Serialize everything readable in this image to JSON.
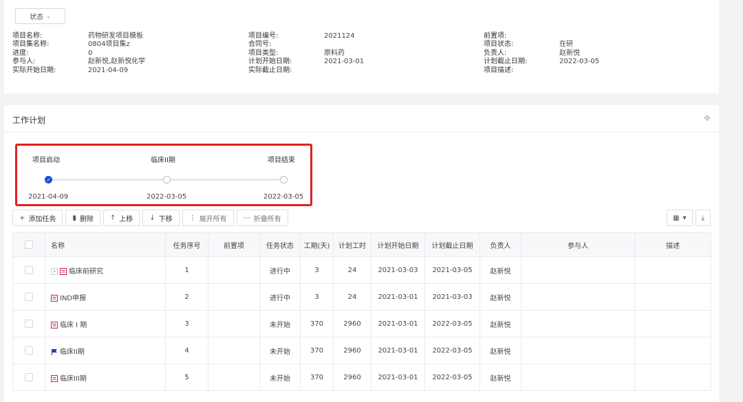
{
  "status_button": {
    "label": "状态",
    "icon": "chevron-down-icon"
  },
  "project_info": {
    "col1": [
      {
        "label": "项目名称:",
        "value": "药物研发项目模板"
      },
      {
        "label": "项目集名称:",
        "value": "0804项目集z"
      },
      {
        "label": "进度:",
        "value": "0"
      },
      {
        "label": "参与人:",
        "value": "赵新悦,赵新悦化学"
      },
      {
        "label": "实际开始日期:",
        "value": "2021-04-09"
      }
    ],
    "col2": [
      {
        "label": "项目编号:",
        "value": "2021124"
      },
      {
        "label": "合同号:",
        "value": ""
      },
      {
        "label": "项目类型:",
        "value": "原料药"
      },
      {
        "label": "计划开始日期:",
        "value": "2021-03-01"
      },
      {
        "label": "实际截止日期:",
        "value": ""
      }
    ],
    "col3": [
      {
        "label": "前置项:",
        "value": ""
      },
      {
        "label": "项目状态:",
        "value": "在研"
      },
      {
        "label": "负责人:",
        "value": "赵新悦"
      },
      {
        "label": "计划截止日期:",
        "value": "2022-03-05"
      },
      {
        "label": "项目描述:",
        "value": ""
      }
    ]
  },
  "plan": {
    "title": "工作计划",
    "milestones": [
      {
        "label": "项目启动",
        "date": "2021-04-09",
        "done": true
      },
      {
        "label": "临床II期",
        "date": "2022-03-05",
        "done": false
      },
      {
        "label": "项目结束",
        "date": "2022-03-05",
        "done": false
      }
    ],
    "highlight_color": "#e02020"
  },
  "toolbar": {
    "add_task": "添加任务",
    "delete": "删除",
    "move_up": "上移",
    "move_down": "下移",
    "expand_all": "展开所有",
    "collapse_all": "折叠所有"
  },
  "table": {
    "headers": [
      "名称",
      "任务序号",
      "前置项",
      "任务状态",
      "工期(天)",
      "计划工时",
      "计划开始日期",
      "计划截止日期",
      "负责人",
      "参与人",
      "描述"
    ],
    "rows": [
      {
        "name": "临床前研究",
        "seq": "1",
        "pre": "",
        "status": "进行中",
        "days": "3",
        "hours": "24",
        "start": "2021-03-03",
        "end": "2021-03-05",
        "owner": "赵新悦",
        "participants": "",
        "desc": "",
        "icon": "red-doc-icon",
        "expandable": true
      },
      {
        "name": "IND申报",
        "seq": "2",
        "pre": "",
        "status": "进行中",
        "days": "3",
        "hours": "24",
        "start": "2021-03-01",
        "end": "2021-03-03",
        "owner": "赵新悦",
        "participants": "",
        "desc": "",
        "icon": "red-doc-icon",
        "expandable": false
      },
      {
        "name": "临床 I 期",
        "seq": "3",
        "pre": "",
        "status": "未开始",
        "days": "370",
        "hours": "2960",
        "start": "2021-03-01",
        "end": "2022-03-05",
        "owner": "赵新悦",
        "participants": "",
        "desc": "",
        "icon": "red-doc-icon",
        "expandable": false
      },
      {
        "name": "临床II期",
        "seq": "4",
        "pre": "",
        "status": "未开始",
        "days": "370",
        "hours": "2960",
        "start": "2021-03-01",
        "end": "2022-03-05",
        "owner": "赵新悦",
        "participants": "",
        "desc": "",
        "icon": "blue-flag-icon",
        "expandable": false
      },
      {
        "name": "临床III期",
        "seq": "5",
        "pre": "",
        "status": "未开始",
        "days": "370",
        "hours": "2960",
        "start": "2021-03-01",
        "end": "2022-03-05",
        "owner": "赵新悦",
        "participants": "",
        "desc": "",
        "icon": "red-doc-icon",
        "expandable": false
      }
    ]
  }
}
